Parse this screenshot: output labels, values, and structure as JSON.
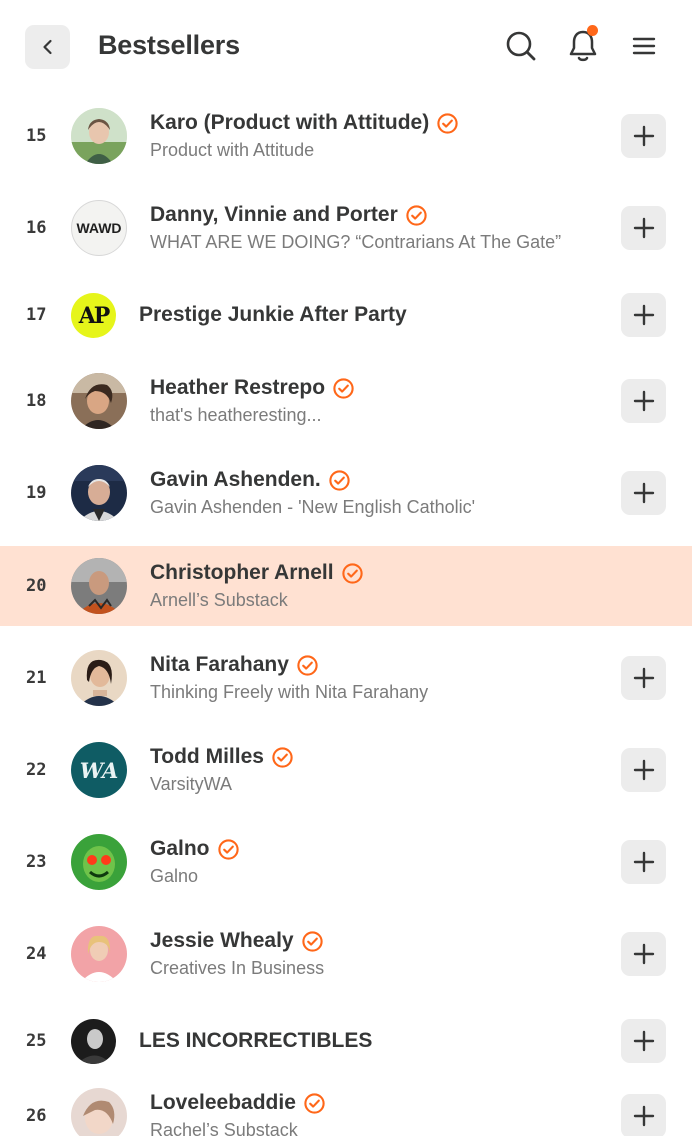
{
  "header": {
    "title": "Bestsellers",
    "back_icon": "chevron-left-icon",
    "search_icon": "search-icon",
    "notifications_icon": "bell-icon",
    "menu_icon": "hamburger-menu-icon",
    "notification_dot_color": "#ff6719"
  },
  "colors": {
    "accent": "#ff6719",
    "highlight_row": "#ffe1d2",
    "button_bg": "#ececec"
  },
  "list": [
    {
      "rank": "15",
      "name": "Karo (Product with Attitude)",
      "subtitle": "Product with Attitude",
      "verified": true
    },
    {
      "rank": "16",
      "name": "Danny, Vinnie and Porter",
      "subtitle": "WHAT ARE WE DOING? “Contrarians At The Gate”",
      "verified": true,
      "avatar_text": "WAWD"
    },
    {
      "rank": "17",
      "name": "Prestige Junkie After Party",
      "subtitle": "",
      "verified": false,
      "avatar_text": "AP"
    },
    {
      "rank": "18",
      "name": "Heather Restrepo",
      "subtitle": "that's heatheresting...",
      "verified": true
    },
    {
      "rank": "19",
      "name": "Gavin Ashenden.",
      "subtitle": "Gavin Ashenden - 'New English Catholic'",
      "verified": true
    },
    {
      "rank": "20",
      "name": "Christopher Arnell",
      "subtitle": "Arnell’s Substack",
      "verified": true,
      "highlighted": true
    },
    {
      "rank": "21",
      "name": "Nita Farahany",
      "subtitle": "Thinking Freely with Nita Farahany",
      "verified": true
    },
    {
      "rank": "22",
      "name": "Todd Milles",
      "subtitle": "VarsityWA",
      "verified": true,
      "avatar_text": "WA"
    },
    {
      "rank": "23",
      "name": "Galno",
      "subtitle": "Galno",
      "verified": true
    },
    {
      "rank": "24",
      "name": "Jessie Whealy",
      "subtitle": "Creatives In Business",
      "verified": true
    },
    {
      "rank": "25",
      "name": "LES INCORRECTIBLES",
      "subtitle": "",
      "verified": false
    },
    {
      "rank": "26",
      "name": "Loveleebaddie",
      "subtitle": "Rachel’s Substack",
      "verified": true
    }
  ]
}
